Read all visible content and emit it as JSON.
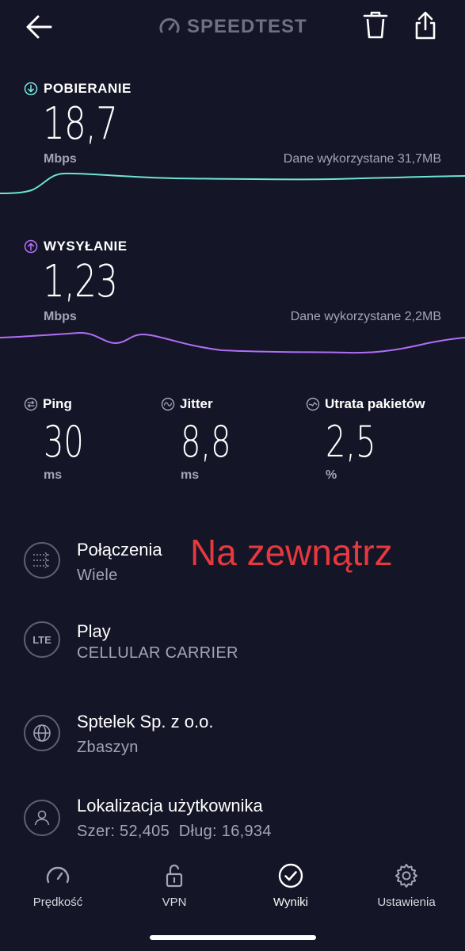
{
  "header": {
    "brand": "SPEEDTEST"
  },
  "download": {
    "title": "POBIERANIE",
    "value": "18,7",
    "unit": "Mbps",
    "data_used": "Dane wykorzystane 31,7MB",
    "color": "#6fe3d6"
  },
  "upload": {
    "title": "WYSYŁANIE",
    "value": "1,23",
    "unit": "Mbps",
    "data_used": "Dane wykorzystane 2,2MB",
    "color": "#b06ef5"
  },
  "metrics": {
    "ping": {
      "title": "Ping",
      "value": "30",
      "unit": "ms"
    },
    "jitter": {
      "title": "Jitter",
      "value": "8,8",
      "unit": "ms"
    },
    "loss": {
      "title": "Utrata pakietów",
      "value": "2,5",
      "unit": "%"
    }
  },
  "info": {
    "connections": {
      "title": "Połączenia",
      "sub": "Wiele"
    },
    "carrier": {
      "title": "Play",
      "sub": "CELLULAR CARRIER",
      "badge": "LTE"
    },
    "server": {
      "title": "Sptelek Sp. z o.o.",
      "sub": "Zbaszyn"
    },
    "location": {
      "title": "Lokalizacja użytkownika",
      "sub": "Szer: 52,405  Dług: 16,934"
    }
  },
  "overlay_note": "Na zewnątrz",
  "nav": {
    "speed": "Prędkość",
    "vpn": "VPN",
    "results": "Wyniki",
    "settings": "Ustawienia"
  }
}
